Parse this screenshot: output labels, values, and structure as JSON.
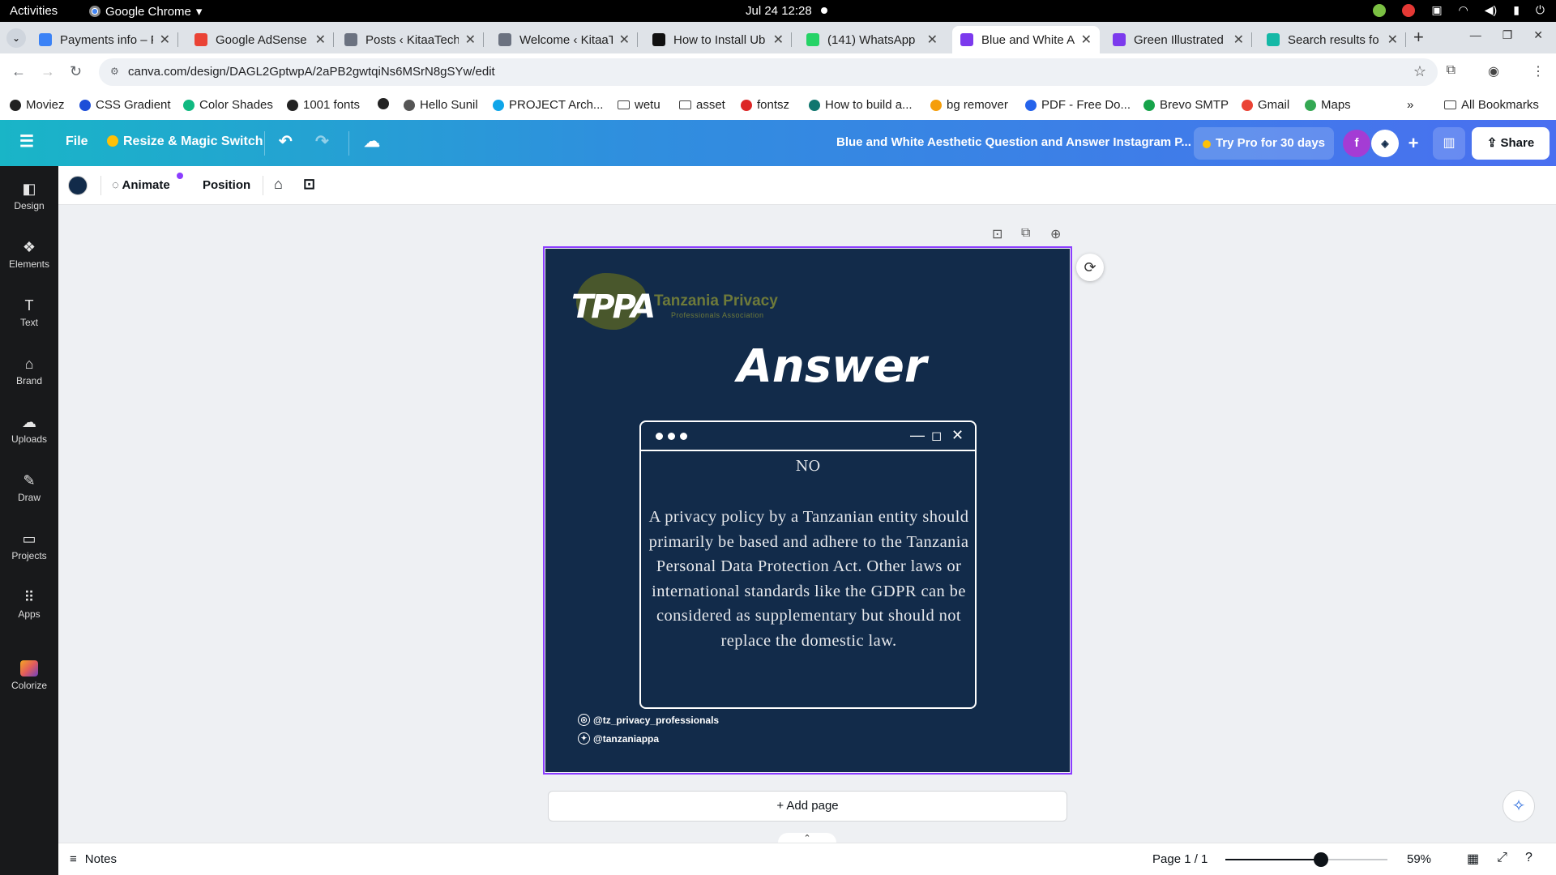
{
  "system": {
    "activities": "Activities",
    "app_name": "Google Chrome",
    "clock": "Jul 24  12:28"
  },
  "tabs": [
    {
      "title": "Payments info – F",
      "icon": "payments-icon",
      "color": "#3b82f6"
    },
    {
      "title": "Google AdSense",
      "icon": "gmail-icon",
      "color": "#ea4335"
    },
    {
      "title": "Posts ‹ KitaaTech",
      "icon": "wordpress-icon",
      "color": "#6b7280"
    },
    {
      "title": "Welcome ‹ KitaaT",
      "icon": "wordpress-icon",
      "color": "#6b7280"
    },
    {
      "title": "How to Install Ub",
      "icon": "ubuntu-icon",
      "color": "#111111"
    },
    {
      "title": "(141) WhatsApp",
      "icon": "whatsapp-icon",
      "color": "#25d366"
    },
    {
      "title": "Blue and White A",
      "icon": "canva-icon",
      "color": "#7c3aed"
    },
    {
      "title": "Green Illustrated",
      "icon": "canva-icon",
      "color": "#7c3aed"
    },
    {
      "title": "Search results fo",
      "icon": "vectorstock-icon",
      "color": "#14b8a6"
    }
  ],
  "address": {
    "url": "canva.com/design/DAGL2GptwpA/2aPB2gwtqiNs6MSrN8gSYw/edit"
  },
  "bookmarks": [
    {
      "label": "Moviez",
      "color": "#222222"
    },
    {
      "label": "CSS Gradient",
      "color": "#1d4ed8"
    },
    {
      "label": "Color Shades",
      "color": "#10b981"
    },
    {
      "label": "1001 fonts",
      "color": "#222222"
    },
    {
      "label": "",
      "color": "#222222"
    },
    {
      "label": "Hello Sunil",
      "color": "#555555"
    },
    {
      "label": "PROJECT Arch...",
      "color": "#0ea5e9"
    },
    {
      "label": "wetu",
      "color": "folder"
    },
    {
      "label": "asset",
      "color": "folder"
    },
    {
      "label": "fontsz",
      "color": "#dc2626"
    },
    {
      "label": "How to build a...",
      "color": "#0f766e"
    },
    {
      "label": "bg remover",
      "color": "#f59e0b"
    },
    {
      "label": "PDF - Free Do...",
      "color": "#2563eb"
    },
    {
      "label": "Brevo SMTP",
      "color": "#16a34a"
    },
    {
      "label": "Gmail",
      "color": "#ea4335"
    },
    {
      "label": "Maps",
      "color": "#34a853"
    }
  ],
  "all_bookmarks": "All Bookmarks",
  "canva": {
    "file": "File",
    "resize": "Resize & Magic Switch",
    "doc_title": "Blue and White Aesthetic Question and Answer Instagram P...",
    "try_pro": "Try Pro for 30 days",
    "avatar_f": "f",
    "share": "Share"
  },
  "sidebar": [
    {
      "label": "Design",
      "icon": "design-icon"
    },
    {
      "label": "Elements",
      "icon": "elements-icon"
    },
    {
      "label": "Text",
      "icon": "text-icon"
    },
    {
      "label": "Brand",
      "icon": "brand-icon"
    },
    {
      "label": "Uploads",
      "icon": "uploads-icon"
    },
    {
      "label": "Draw",
      "icon": "draw-icon"
    },
    {
      "label": "Projects",
      "icon": "projects-icon"
    },
    {
      "label": "Apps",
      "icon": "apps-icon"
    },
    {
      "label": "Colorize",
      "icon": "colorize-icon"
    }
  ],
  "context_toolbar": {
    "swatch_color": "#122b4a",
    "animate": "Animate",
    "position": "Position"
  },
  "design": {
    "background": "#122b4a",
    "logo_mark": "TPPA",
    "logo_name": "Tanzania Privacy",
    "logo_sub": "Professionals Association",
    "heading": "Answer",
    "short_answer": "NO",
    "body": "A privacy policy by a Tanzanian entity should primarily be based and adhere to the Tanzania Personal Data Protection Act. Other laws or international standards like the GDPR can be considered as supplementary but should not replace the domestic law.",
    "instagram": "@tz_privacy_professionals",
    "twitter": "@tanzaniappa"
  },
  "add_page": "+ Add page",
  "footer": {
    "notes": "Notes",
    "page_indicator": "Page 1 / 1",
    "zoom": "59%",
    "zoom_level": 0.59
  }
}
